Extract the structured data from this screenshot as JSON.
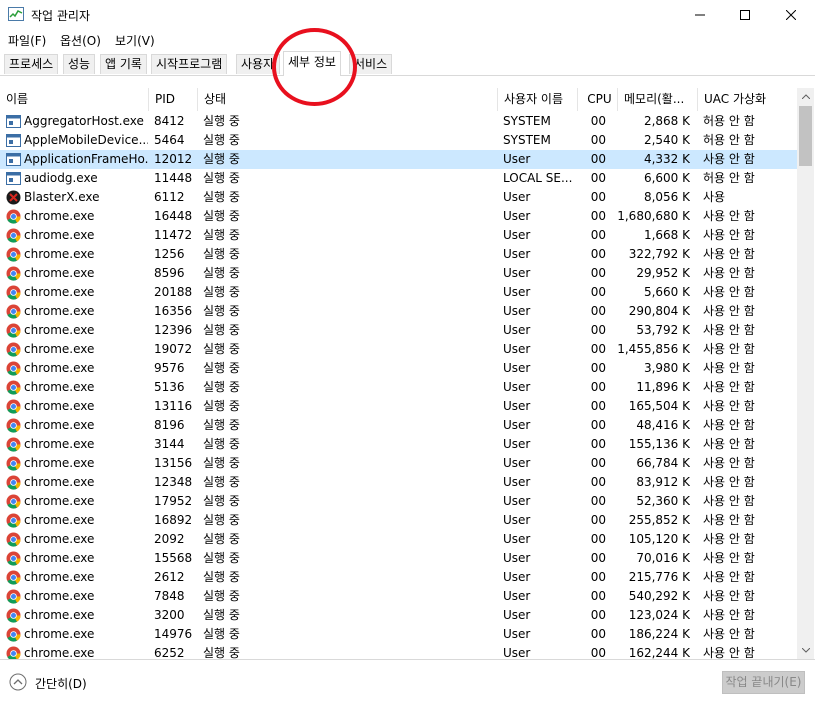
{
  "window": {
    "title": "작업 관리자"
  },
  "menu": [
    "파일(F)",
    "옵션(O)",
    "보기(V)"
  ],
  "tabs": [
    "프로세스",
    "성능",
    "앱 기록",
    "시작프로그램",
    "사용자",
    "세부 정보",
    "서비스"
  ],
  "active_tab": "세부 정보",
  "columns": [
    "이름",
    "PID",
    "상태",
    "사용자 이름",
    "CPU",
    "메모리(활...",
    "UAC 가상화"
  ],
  "rows": [
    {
      "name": "AggregatorHost.exe",
      "pid": "8412",
      "status": "실행 중",
      "user": "SYSTEM",
      "cpu": "00",
      "mem": "2,868 K",
      "uac": "허용 안 함",
      "icon": "window-icon"
    },
    {
      "name": "AppleMobileDevice...",
      "pid": "5464",
      "status": "실행 중",
      "user": "SYSTEM",
      "cpu": "00",
      "mem": "2,540 K",
      "uac": "허용 안 함",
      "icon": "window-icon"
    },
    {
      "name": "ApplicationFrameHo...",
      "pid": "12012",
      "status": "실행 중",
      "user": "User",
      "cpu": "00",
      "mem": "4,332 K",
      "uac": "사용 안 함",
      "icon": "window-icon",
      "selected": true
    },
    {
      "name": "audiodg.exe",
      "pid": "11448",
      "status": "실행 중",
      "user": "LOCAL SE...",
      "cpu": "00",
      "mem": "6,600 K",
      "uac": "허용 안 함",
      "icon": "window-icon"
    },
    {
      "name": "BlasterX.exe",
      "pid": "6112",
      "status": "실행 중",
      "user": "User",
      "cpu": "00",
      "mem": "8,056 K",
      "uac": "사용",
      "icon": "blasterx-icon"
    },
    {
      "name": "chrome.exe",
      "pid": "16448",
      "status": "실행 중",
      "user": "User",
      "cpu": "00",
      "mem": "1,680,680 K",
      "uac": "사용 안 함",
      "icon": "chrome-icon"
    },
    {
      "name": "chrome.exe",
      "pid": "11472",
      "status": "실행 중",
      "user": "User",
      "cpu": "00",
      "mem": "1,668 K",
      "uac": "사용 안 함",
      "icon": "chrome-icon"
    },
    {
      "name": "chrome.exe",
      "pid": "1256",
      "status": "실행 중",
      "user": "User",
      "cpu": "00",
      "mem": "322,792 K",
      "uac": "사용 안 함",
      "icon": "chrome-icon"
    },
    {
      "name": "chrome.exe",
      "pid": "8596",
      "status": "실행 중",
      "user": "User",
      "cpu": "00",
      "mem": "29,952 K",
      "uac": "사용 안 함",
      "icon": "chrome-icon"
    },
    {
      "name": "chrome.exe",
      "pid": "20188",
      "status": "실행 중",
      "user": "User",
      "cpu": "00",
      "mem": "5,660 K",
      "uac": "사용 안 함",
      "icon": "chrome-icon"
    },
    {
      "name": "chrome.exe",
      "pid": "16356",
      "status": "실행 중",
      "user": "User",
      "cpu": "00",
      "mem": "290,804 K",
      "uac": "사용 안 함",
      "icon": "chrome-icon"
    },
    {
      "name": "chrome.exe",
      "pid": "12396",
      "status": "실행 중",
      "user": "User",
      "cpu": "00",
      "mem": "53,792 K",
      "uac": "사용 안 함",
      "icon": "chrome-icon"
    },
    {
      "name": "chrome.exe",
      "pid": "19072",
      "status": "실행 중",
      "user": "User",
      "cpu": "00",
      "mem": "1,455,856 K",
      "uac": "사용 안 함",
      "icon": "chrome-icon"
    },
    {
      "name": "chrome.exe",
      "pid": "9576",
      "status": "실행 중",
      "user": "User",
      "cpu": "00",
      "mem": "3,980 K",
      "uac": "사용 안 함",
      "icon": "chrome-icon"
    },
    {
      "name": "chrome.exe",
      "pid": "5136",
      "status": "실행 중",
      "user": "User",
      "cpu": "00",
      "mem": "11,896 K",
      "uac": "사용 안 함",
      "icon": "chrome-icon"
    },
    {
      "name": "chrome.exe",
      "pid": "13116",
      "status": "실행 중",
      "user": "User",
      "cpu": "00",
      "mem": "165,504 K",
      "uac": "사용 안 함",
      "icon": "chrome-icon"
    },
    {
      "name": "chrome.exe",
      "pid": "8196",
      "status": "실행 중",
      "user": "User",
      "cpu": "00",
      "mem": "48,416 K",
      "uac": "사용 안 함",
      "icon": "chrome-icon"
    },
    {
      "name": "chrome.exe",
      "pid": "3144",
      "status": "실행 중",
      "user": "User",
      "cpu": "00",
      "mem": "155,136 K",
      "uac": "사용 안 함",
      "icon": "chrome-icon"
    },
    {
      "name": "chrome.exe",
      "pid": "13156",
      "status": "실행 중",
      "user": "User",
      "cpu": "00",
      "mem": "66,784 K",
      "uac": "사용 안 함",
      "icon": "chrome-icon"
    },
    {
      "name": "chrome.exe",
      "pid": "12348",
      "status": "실행 중",
      "user": "User",
      "cpu": "00",
      "mem": "83,912 K",
      "uac": "사용 안 함",
      "icon": "chrome-icon"
    },
    {
      "name": "chrome.exe",
      "pid": "17952",
      "status": "실행 중",
      "user": "User",
      "cpu": "00",
      "mem": "52,360 K",
      "uac": "사용 안 함",
      "icon": "chrome-icon"
    },
    {
      "name": "chrome.exe",
      "pid": "16892",
      "status": "실행 중",
      "user": "User",
      "cpu": "00",
      "mem": "255,852 K",
      "uac": "사용 안 함",
      "icon": "chrome-icon"
    },
    {
      "name": "chrome.exe",
      "pid": "2092",
      "status": "실행 중",
      "user": "User",
      "cpu": "00",
      "mem": "105,120 K",
      "uac": "사용 안 함",
      "icon": "chrome-icon"
    },
    {
      "name": "chrome.exe",
      "pid": "15568",
      "status": "실행 중",
      "user": "User",
      "cpu": "00",
      "mem": "70,016 K",
      "uac": "사용 안 함",
      "icon": "chrome-icon"
    },
    {
      "name": "chrome.exe",
      "pid": "2612",
      "status": "실행 중",
      "user": "User",
      "cpu": "00",
      "mem": "215,776 K",
      "uac": "사용 안 함",
      "icon": "chrome-icon"
    },
    {
      "name": "chrome.exe",
      "pid": "7848",
      "status": "실행 중",
      "user": "User",
      "cpu": "00",
      "mem": "540,292 K",
      "uac": "사용 안 함",
      "icon": "chrome-icon"
    },
    {
      "name": "chrome.exe",
      "pid": "3200",
      "status": "실행 중",
      "user": "User",
      "cpu": "00",
      "mem": "123,024 K",
      "uac": "사용 안 함",
      "icon": "chrome-icon"
    },
    {
      "name": "chrome.exe",
      "pid": "14976",
      "status": "실행 중",
      "user": "User",
      "cpu": "00",
      "mem": "186,224 K",
      "uac": "사용 안 함",
      "icon": "chrome-icon"
    },
    {
      "name": "chrome.exe",
      "pid": "6252",
      "status": "실행 중",
      "user": "User",
      "cpu": "00",
      "mem": "162,244 K",
      "uac": "사용 안 함",
      "icon": "chrome-icon"
    }
  ],
  "footer": {
    "fewer_details": "간단히(D)",
    "end_task": "작업 끝내기(E)"
  },
  "colors": {
    "selection": "#cce8ff",
    "annotation_circle": "#e8101e"
  }
}
